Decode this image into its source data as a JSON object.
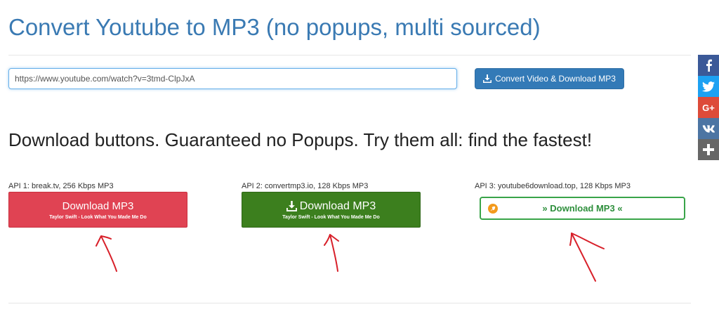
{
  "header": {
    "title": "Convert Youtube to MP3 (no popups, multi sourced)"
  },
  "form": {
    "url_value": "https://www.youtube.com/watch?v=3tmd-ClpJxA",
    "convert_label": "Convert Video & Download MP3"
  },
  "downloads": {
    "heading": "Download buttons. Guaranteed no Popups. Try them all: find the fastest!",
    "apis": [
      {
        "label": "API 1: break.tv, 256 Kbps MP3",
        "button": "Download MP3",
        "song": "Taylor Swift - Look What You Made Me Do",
        "color": "#e04353"
      },
      {
        "label": "API 2: convertmp3.io, 128 Kbps MP3",
        "button": "Download MP3",
        "song": "Taylor Swift - Look What You Made Me Do",
        "color": "#3c7f1e"
      },
      {
        "label": "API 3: youtube6download.top, 128 Kbps MP3",
        "button": "» Download MP3 «",
        "color": "#39a449"
      }
    ]
  },
  "share": [
    {
      "icon": "facebook-icon",
      "color": "#3b5998"
    },
    {
      "icon": "twitter-icon",
      "color": "#1da1f2"
    },
    {
      "icon": "google-plus-icon",
      "color": "#dd4b39",
      "text": "G+"
    },
    {
      "icon": "vk-icon",
      "color": "#4c75a3"
    },
    {
      "icon": "plus-icon",
      "color": "#666666"
    }
  ],
  "theme": {
    "accent": "#337ab7",
    "title_color": "#3a7ab3",
    "annotation_color": "#d8202a"
  }
}
